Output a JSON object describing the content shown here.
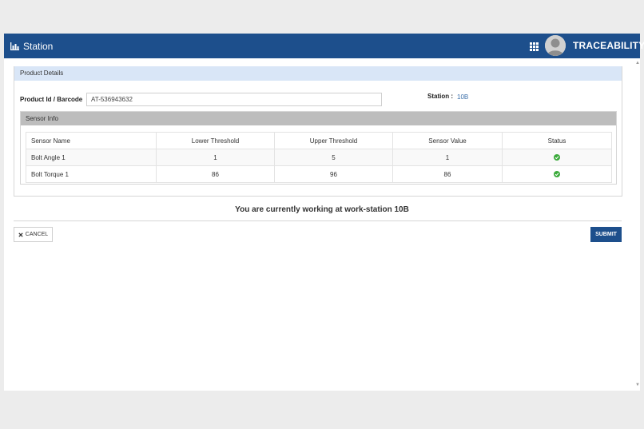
{
  "header": {
    "title": "Station",
    "app_name": "TRACEABILITY",
    "brand_icon": "bar-chart-icon",
    "apps_icon": "grid-icon",
    "avatar_icon": "user-avatar-icon",
    "color": "#1d4f8c"
  },
  "product": {
    "panel_title": "Product Details",
    "id_label": "Product Id / Barcode",
    "id_value": "AT-536943632",
    "station_label": "Station :",
    "station_value": "10B"
  },
  "sensor": {
    "panel_title": "Sensor Info",
    "columns": [
      "Sensor Name",
      "Lower Threshold",
      "Upper Threshold",
      "Sensor Value",
      "Status"
    ],
    "rows": [
      {
        "name": "Bolt Angle 1",
        "lower": "1",
        "upper": "5",
        "value": "1",
        "status": "check-circle-icon"
      },
      {
        "name": "Bolt Torque 1",
        "lower": "86",
        "upper": "96",
        "value": "86",
        "status": "check-circle-icon"
      }
    ],
    "status_color": "#3cab3c"
  },
  "message": "You are currently working at work-station 10B",
  "actions": {
    "cancel_label": "CANCEL",
    "cancel_icon": "close-icon",
    "submit_label": "SUBMIT"
  }
}
